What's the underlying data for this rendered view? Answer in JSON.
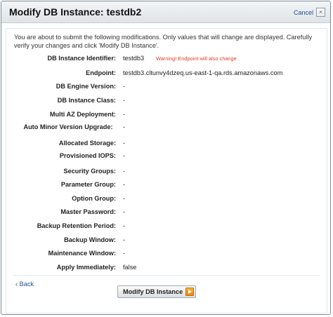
{
  "dialog": {
    "title": "Modify DB Instance:  testdb2",
    "cancel_label": "Cancel",
    "close_glyph": "×"
  },
  "intro": "You are about to submit the following modifications. Only values that will change are displayed. Carefully verify your changes and click 'Modify DB Instance'.",
  "rows": [
    {
      "label": "DB Instance Identifier:",
      "value": "testdb3",
      "warning": "Warning! Endpoint will also change"
    },
    {
      "label": "Endpoint:",
      "value": "testdb3.cltunvy4dzeq.us-east-1-qa.rds.amazonaws.com"
    },
    {
      "label": "DB Engine Version:",
      "value": "-"
    },
    {
      "label": "DB Instance Class:",
      "value": "-"
    },
    {
      "label": "Multi AZ Deployment:",
      "value": "-"
    },
    {
      "label": "Auto Minor Version Upgrade:",
      "value": "-"
    },
    {
      "label": "Allocated Storage:",
      "value": "-"
    },
    {
      "label": "Provisioned IOPS:",
      "value": "-"
    },
    {
      "label": "Security Groups:",
      "value": "-"
    },
    {
      "label": "Parameter Group:",
      "value": "-"
    },
    {
      "label": "Option Group:",
      "value": "-"
    },
    {
      "label": "Master Password:",
      "value": "-"
    },
    {
      "label": "Backup Retention Period:",
      "value": "-"
    },
    {
      "label": "Backup Window:",
      "value": "-"
    },
    {
      "label": "Maintenance Window:",
      "value": "-"
    },
    {
      "label": "Apply Immediately:",
      "value": "false"
    }
  ],
  "footer": {
    "back_label": "‹ Back",
    "submit_label": "Modify DB Instance"
  },
  "colors": {
    "warning": "#e03a2a",
    "link": "#1d4f91",
    "button_arrow": "#f19a1b"
  },
  "icons": {
    "close": "close-icon",
    "submit_arrow": "arrow-right-icon"
  }
}
